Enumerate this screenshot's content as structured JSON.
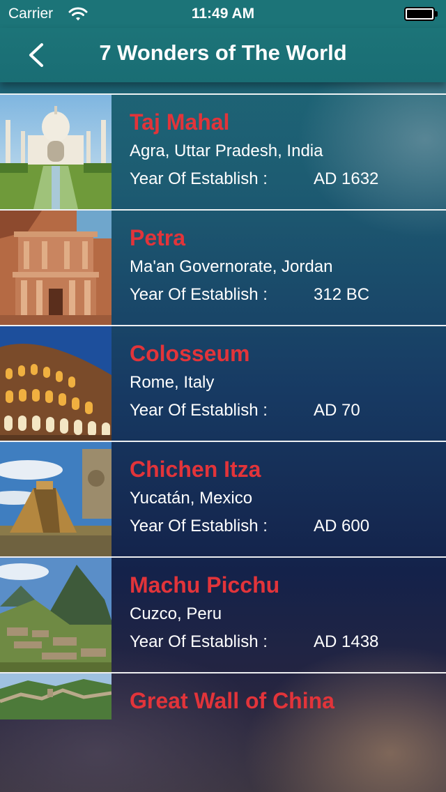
{
  "status_bar": {
    "carrier": "Carrier",
    "time": "11:49 AM",
    "icons": [
      "wifi-icon",
      "battery-icon"
    ]
  },
  "nav": {
    "title": "7 Wonders of The World",
    "back_icon": "chevron-left-icon"
  },
  "wonders": [
    {
      "name": "Taj Mahal",
      "location": "Agra, Uttar Pradesh, India",
      "year_label": "Year Of Establish :",
      "year": "AD 1632"
    },
    {
      "name": "Petra",
      "location": "Ma'an Governorate, Jordan",
      "year_label": "Year Of Establish :",
      "year": "312 BC"
    },
    {
      "name": "Colosseum",
      "location": "Rome, Italy",
      "year_label": "Year Of Establish :",
      "year": "AD 70"
    },
    {
      "name": "Chichen Itza",
      "location": "Yucatán, Mexico",
      "year_label": "Year Of Establish :",
      "year": "AD 600"
    },
    {
      "name": "Machu Picchu",
      "location": "Cuzco, Peru",
      "year_label": "Year Of Establish :",
      "year": "AD 1438"
    },
    {
      "name": "Great Wall of China"
    }
  ],
  "colors": {
    "nav_background": "#1c7478",
    "title_red": "#e2343a",
    "text_white": "#ffffff"
  }
}
